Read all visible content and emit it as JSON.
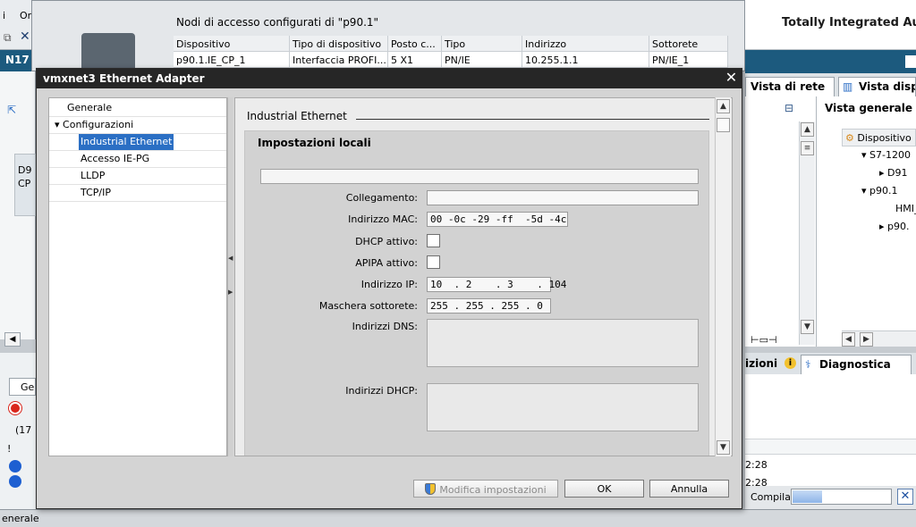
{
  "background": {
    "toolbar_labels": [
      "i",
      "Or"
    ],
    "left_strip_title": "N17",
    "left_panel_texts": [
      "D9",
      "CP"
    ],
    "left_bottom_tab": "Ge",
    "left_bottom_count": "(17",
    "left_bottom_mark": "!",
    "status_left": "enerale",
    "top_window": {
      "caption": "Nodi di accesso configurati di \"p90.1\"",
      "columns": [
        "Dispositivo",
        "Tipo di dispositivo",
        "Posto c...",
        "Tipo",
        "Indirizzo",
        "Sottorete"
      ],
      "rows": [
        [
          "p90.1.IE_CP_1",
          "Interfaccia PROFI...",
          "5 X1",
          "PN/IE",
          "10.255.1.1",
          "PN/IE_1"
        ]
      ]
    },
    "right_panel": {
      "app_title": "Totally Integrated Auto",
      "tab_network": "Vista di rete",
      "tab_device": "Vista disp",
      "overview_title": "Vista generale",
      "column_header": "Dispositivo",
      "tree": [
        "S7-1200",
        "D91",
        "p90.1",
        "HMI_",
        "p90."
      ],
      "tab_info_partial": "izioni",
      "tab_diagnostics": "Diagnostica",
      "log_times": [
        "2:28",
        "2:28"
      ],
      "compile_label": "Compila:",
      "compile_progress": 0.3
    }
  },
  "dialog": {
    "title": "vmxnet3 Ethernet Adapter",
    "nav": {
      "general": "Generale",
      "configurations": "Configurazioni",
      "children": [
        "Industrial Ethernet",
        "Accesso IE-PG",
        "LLDP",
        "TCP/IP"
      ],
      "selected": "Industrial Ethernet"
    },
    "section_title": "Industrial Ethernet",
    "group_title": "Impostazioni locali",
    "fields": {
      "connection_label": "Collegamento:",
      "connection_value": "",
      "mac_label": "Indirizzo MAC:",
      "mac_value": "00 -0c -29 -ff  -5d -4c",
      "dhcp_label": "DHCP attivo:",
      "dhcp_checked": false,
      "apipa_label": "APIPA attivo:",
      "apipa_checked": false,
      "ip_label": "Indirizzo IP:",
      "ip_value": "10  . 2    . 3    . 104",
      "mask_label": "Maschera sottorete:",
      "mask_value": "255 . 255 . 255 . 0",
      "dns_label": "Indirizzi DNS:",
      "dhcp_addr_label": "Indirizzi DHCP:"
    },
    "buttons": {
      "modify": "Modifica impostazioni",
      "ok": "OK",
      "cancel": "Annulla"
    }
  }
}
